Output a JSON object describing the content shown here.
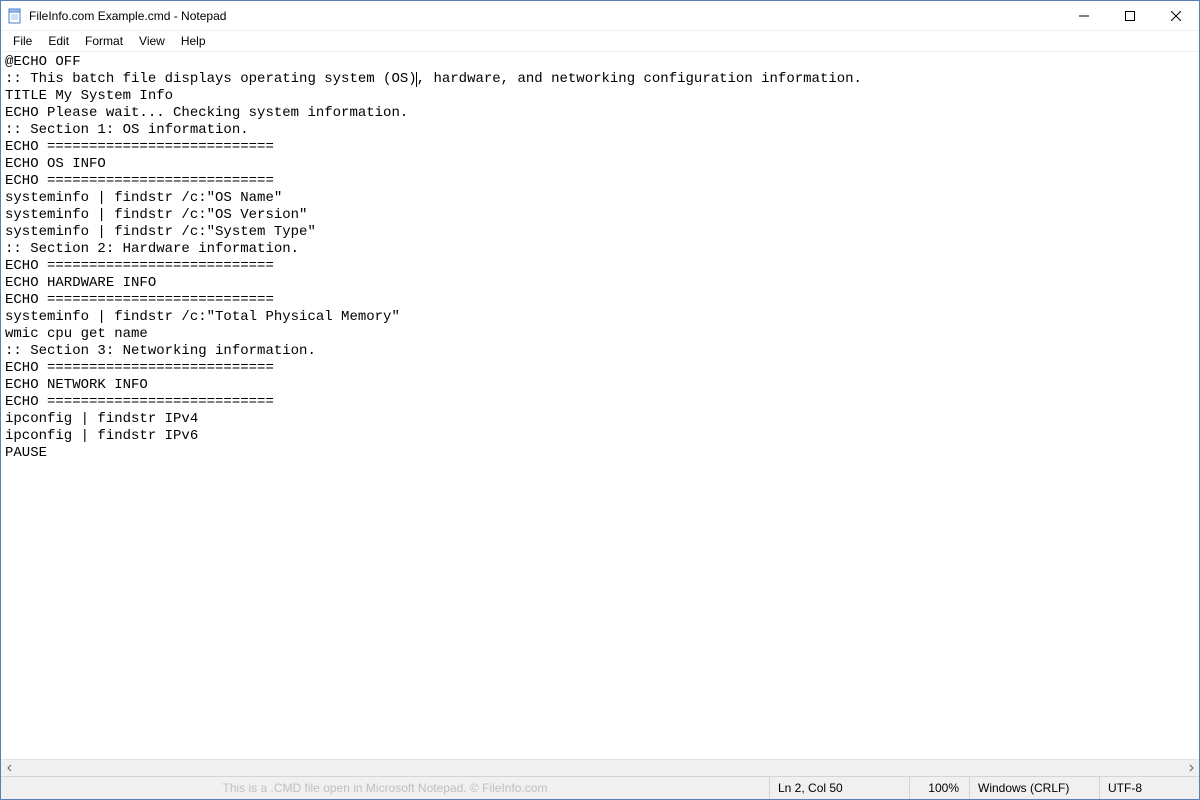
{
  "window": {
    "title": "FileInfo.com Example.cmd - Notepad"
  },
  "menu": {
    "file": "File",
    "edit": "Edit",
    "format": "Format",
    "view": "View",
    "help": "Help"
  },
  "editor": {
    "pre_caret": "@ECHO OFF\n:: This batch file displays operating system (OS)",
    "post_caret": ", hardware, and networking configuration information.\nTITLE My System Info\nECHO Please wait... Checking system information.\n:: Section 1: OS information.\nECHO ===========================\nECHO OS INFO\nECHO ===========================\nsysteminfo | findstr /c:\"OS Name\"\nsysteminfo | findstr /c:\"OS Version\"\nsysteminfo | findstr /c:\"System Type\"\n:: Section 2: Hardware information.\nECHO ===========================\nECHO HARDWARE INFO\nECHO ===========================\nsysteminfo | findstr /c:\"Total Physical Memory\"\nwmic cpu get name\n:: Section 3: Networking information.\nECHO ===========================\nECHO NETWORK INFO\nECHO ===========================\nipconfig | findstr IPv4\nipconfig | findstr IPv6\nPAUSE"
  },
  "statusbar": {
    "watermark": "This is a .CMD file open in Microsoft Notepad. © FileInfo.com",
    "position": "Ln 2, Col 50",
    "zoom": "100%",
    "line_ending": "Windows (CRLF)",
    "encoding": "UTF-8"
  }
}
